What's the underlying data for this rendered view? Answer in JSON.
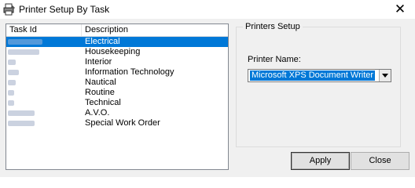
{
  "window": {
    "title": "Printer Setup By Task",
    "close_glyph": "✕",
    "icon": "printer-app-icon"
  },
  "task_list": {
    "columns": [
      "Task Id",
      "Description"
    ],
    "rows": [
      {
        "id": "",
        "description": "Electrical",
        "selected": true
      },
      {
        "id": "",
        "description": "Housekeeping"
      },
      {
        "id": "",
        "description": "Interior"
      },
      {
        "id": "",
        "description": "Information Technology"
      },
      {
        "id": "",
        "description": "Nautical"
      },
      {
        "id": "",
        "description": "Routine"
      },
      {
        "id": "",
        "description": "Technical"
      },
      {
        "id": "",
        "description": "A.V.O."
      },
      {
        "id": "",
        "description": "Special Work Order"
      }
    ],
    "selection_color": "#0078d7"
  },
  "printers_setup": {
    "caption": "Printers Setup",
    "printer_name_label": "Printer Name:",
    "printer_name_value": "Microsoft XPS Document Writer"
  },
  "buttons": {
    "apply_label": "Apply",
    "close_label": "Close"
  }
}
